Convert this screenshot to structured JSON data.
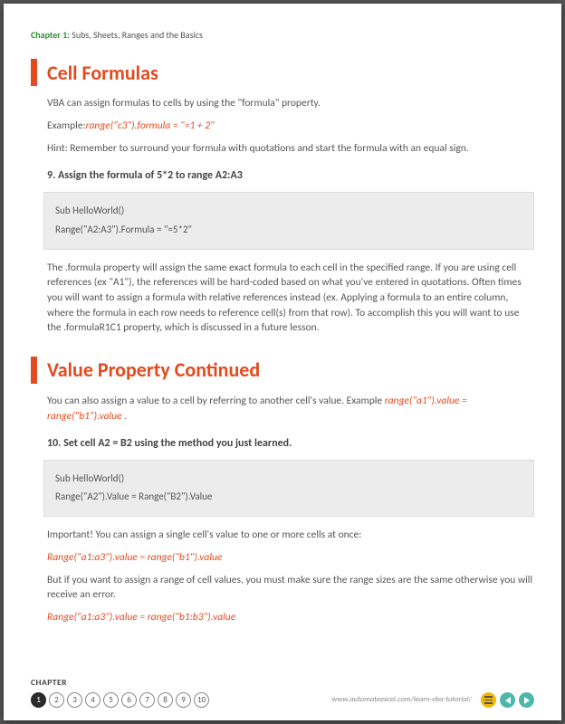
{
  "header": {
    "chapter_label": "Chapter 1:",
    "chapter_title": "Subs, Sheets, Ranges and the Basics"
  },
  "section1": {
    "heading": "Cell Formulas",
    "p1": "VBA can assign formulas to cells by using the \"formula\" property.",
    "p2_prefix": "Example:",
    "p2_code": "range(\"c3\").formula = \"=1 + 2\"",
    "p3": "Hint: Remember to surround your formula with quotations and start the formula with an equal sign.",
    "task": "9.  Assign the formula of 5*2 to range A2:A3",
    "code_l1": "Sub HelloWorld()",
    "code_l2": "Range(\"A2:A3\").Formula = \"=5*2\"",
    "p4": "The .formula property will assign the same exact formula to each cell in the specified range. If you are using cell references (ex \"A1\"), the references will be hard-coded based on what you've entered in quotations. Often times you will want to assign a formula with relative references instead (ex. Applying a formula to an entire column, where the formula in each row needs to reference cell(s) from that row). To accomplish this you will want to use the .formulaR1C1 property, which is discussed in a future lesson."
  },
  "section2": {
    "heading": "Value Property Continued",
    "p1_a": "You can also assign a value to a cell by referring to another cell's value. Example ",
    "p1_code": "range(\"a1\").value = range(\"b1\").value .",
    "task": "10.    Set cell A2 = B2 using the method you just learned.",
    "code_l1": "Sub HelloWorld()",
    "code_l2": "Range(\"A2\").Value = Range(\"B2\").Value",
    "p2": "Important! You can assign a single cell's value to one or more cells at once:",
    "code_inline1": "Range(\"a1:a3\").value = range(\"b1\").value",
    "p3": "But if you want to assign a range of cell values, you must make sure the range sizes are the same otherwise you will receive an error.",
    "code_inline2": "Range(\"a1:a3\").value = range(\"b1:b3\").value"
  },
  "footer": {
    "chapter_label": "CHAPTER",
    "pages": [
      "1",
      "2",
      "3",
      "4",
      "5",
      "6",
      "7",
      "8",
      "9",
      "10"
    ],
    "active_page": "1",
    "url": "www.automateexcel.com/learn-vba-tutorial/"
  }
}
